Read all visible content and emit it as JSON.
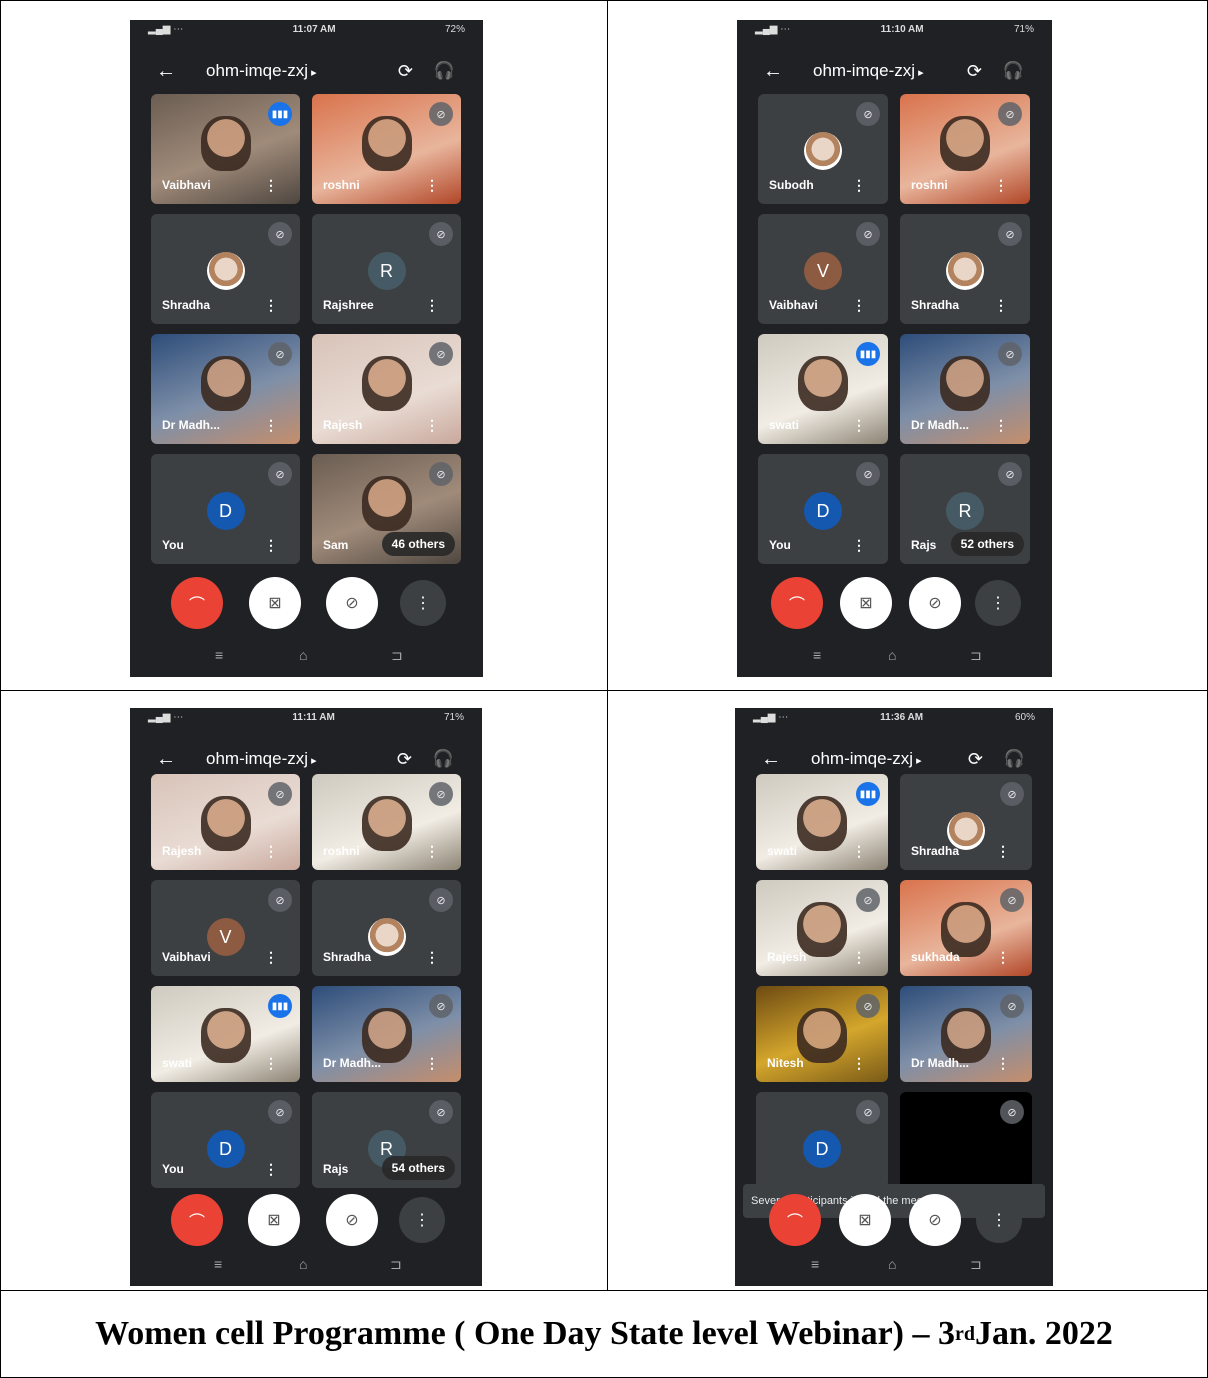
{
  "caption": {
    "pre": "Women cell  Programme  ( One Day State level  Webinar) – 3",
    "sup": "rd",
    "post": " Jan. 2022"
  },
  "screens": [
    {
      "time": "11:07 AM",
      "battery": "72%",
      "meeting_code": "ohm-imqe-zxj",
      "tiles": [
        {
          "name": "Vaibhavi",
          "kind": "video",
          "style": "",
          "indicator": "speak"
        },
        {
          "name": "roshni",
          "kind": "video",
          "style": "orange",
          "indicator": "mute"
        },
        {
          "name": "Shradha",
          "kind": "photo",
          "indicator": "mute"
        },
        {
          "name": "Rajshree",
          "kind": "letter",
          "letter": "R",
          "color": "#455a64",
          "indicator": "mute"
        },
        {
          "name": "Dr Madh...",
          "kind": "video",
          "style": "blue",
          "indicator": "mute"
        },
        {
          "name": "Rajesh",
          "kind": "video",
          "style": "logo",
          "indicator": "mute"
        },
        {
          "name": "You",
          "kind": "letter",
          "letter": "D",
          "color": "#1558b0",
          "indicator": "mute"
        },
        {
          "name": "Sam",
          "kind": "video",
          "style": "",
          "indicator": "mute",
          "others": "46 others"
        }
      ]
    },
    {
      "time": "11:10 AM",
      "battery": "71%",
      "meeting_code": "ohm-imqe-zxj",
      "tiles": [
        {
          "name": "Subodh",
          "kind": "photo",
          "indicator": "mute"
        },
        {
          "name": "roshni",
          "kind": "video",
          "style": "orange",
          "indicator": "mute"
        },
        {
          "name": "Vaibhavi",
          "kind": "letter",
          "letter": "V",
          "color": "#8d5a42",
          "indicator": "mute"
        },
        {
          "name": "Shradha",
          "kind": "photo",
          "indicator": "mute"
        },
        {
          "name": "swati",
          "kind": "video",
          "style": "white",
          "indicator": "speak"
        },
        {
          "name": "Dr Madh...",
          "kind": "video",
          "style": "blue",
          "indicator": "mute"
        },
        {
          "name": "You",
          "kind": "letter",
          "letter": "D",
          "color": "#1558b0",
          "indicator": "mute"
        },
        {
          "name": "Rajs",
          "kind": "letter",
          "letter": "R",
          "color": "#455a64",
          "indicator": "mute",
          "others": "52 others"
        }
      ]
    },
    {
      "time": "11:11 AM",
      "battery": "71%",
      "meeting_code": "ohm-imqe-zxj",
      "tiles": [
        {
          "name": "Rajesh",
          "kind": "video",
          "style": "logo",
          "indicator": "mute"
        },
        {
          "name": "roshni",
          "kind": "video",
          "style": "white",
          "indicator": "mute"
        },
        {
          "name": "Vaibhavi",
          "kind": "letter",
          "letter": "V",
          "color": "#8d5a42",
          "indicator": "mute"
        },
        {
          "name": "Shradha",
          "kind": "photo",
          "indicator": "mute"
        },
        {
          "name": "swati",
          "kind": "video",
          "style": "white",
          "indicator": "speak"
        },
        {
          "name": "Dr Madh...",
          "kind": "video",
          "style": "blue",
          "indicator": "mute"
        },
        {
          "name": "You",
          "kind": "letter",
          "letter": "D",
          "color": "#1558b0",
          "indicator": "mute"
        },
        {
          "name": "Rajs",
          "kind": "letter",
          "letter": "R",
          "color": "#455a64",
          "indicator": "mute",
          "others": "54 others"
        }
      ]
    },
    {
      "time": "11:36 AM",
      "battery": "60%",
      "meeting_code": "ohm-imqe-zxj",
      "toast": "Several participants joined the meeting",
      "tiles": [
        {
          "name": "swati",
          "kind": "video",
          "style": "white",
          "indicator": "speak"
        },
        {
          "name": "Shradha",
          "kind": "photo",
          "indicator": "mute"
        },
        {
          "name": "Rajesh",
          "kind": "video",
          "style": "white",
          "indicator": "mute"
        },
        {
          "name": "sukhada",
          "kind": "video",
          "style": "orange",
          "indicator": "mute"
        },
        {
          "name": "Nitesh",
          "kind": "video",
          "style": "gold",
          "indicator": "mute"
        },
        {
          "name": "Dr Madh...",
          "kind": "video",
          "style": "blue",
          "indicator": "mute"
        },
        {
          "name": "",
          "kind": "letter",
          "letter": "D",
          "color": "#1558b0",
          "indicator": "mute"
        },
        {
          "name": "",
          "kind": "black",
          "indicator": "mute"
        }
      ]
    }
  ],
  "icons": {
    "back": "arrow-left-icon",
    "flip": "camera-flip-icon",
    "audio": "headphones-icon",
    "end": "end-call-icon",
    "camera": "camera-off-icon",
    "mic": "mic-off-icon",
    "more": "more-vert-icon"
  },
  "colors": {
    "end_call": "#ea4335",
    "speaking": "#1a73e8",
    "background": "#202124"
  }
}
